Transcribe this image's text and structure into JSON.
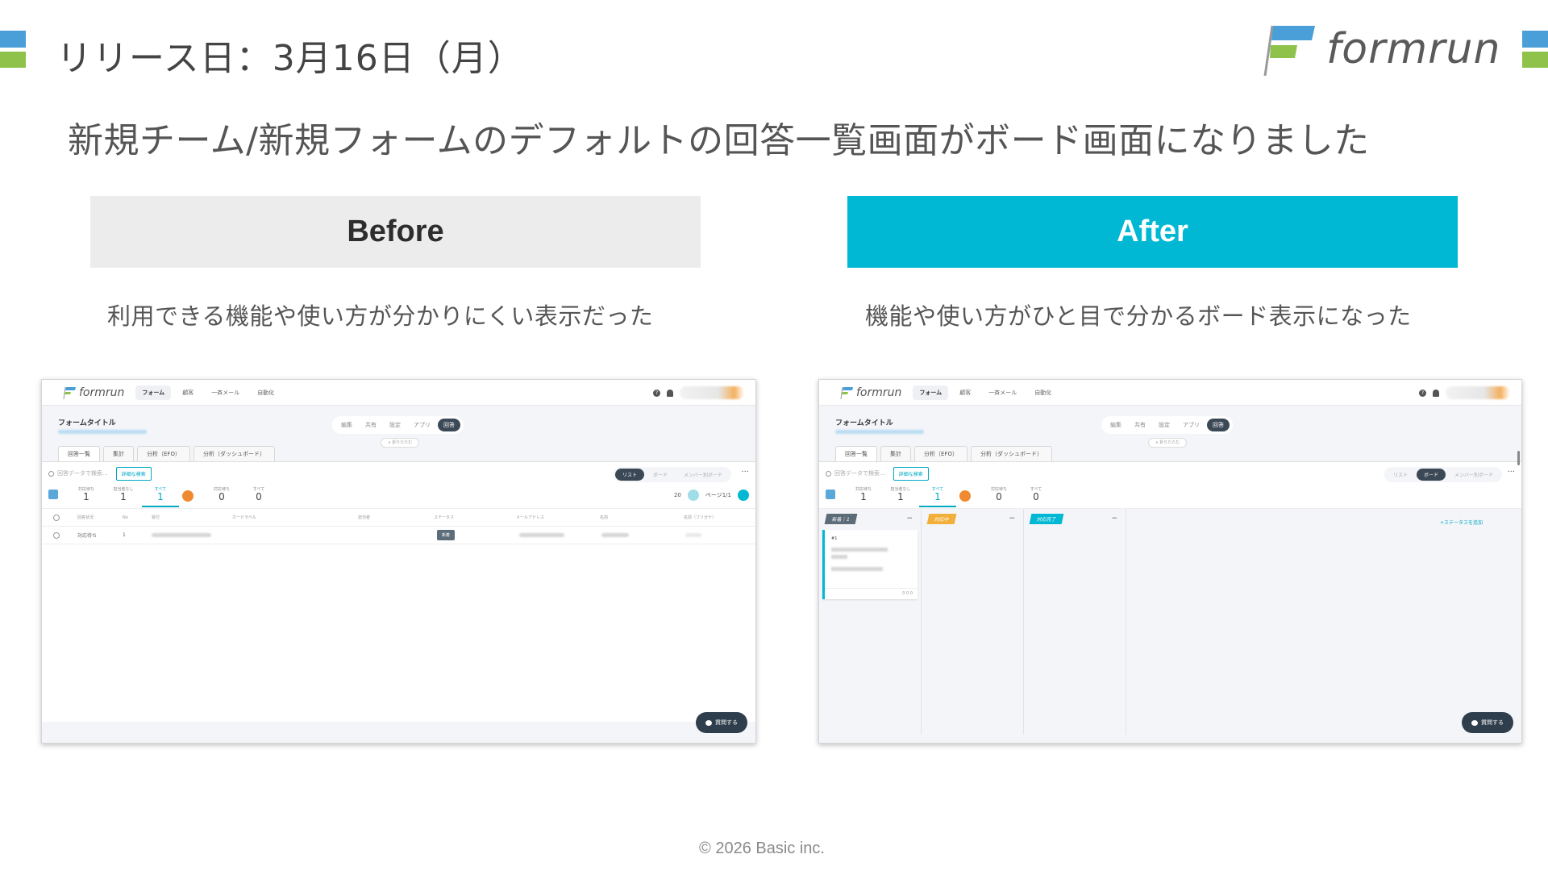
{
  "slide": {
    "release_text": "リリース日：3月16日（月）",
    "brand_name": "formrun",
    "headline": "新規チーム/新規フォームのデフォルトの回答一覧画面がボード画面になりました",
    "before_label": "Before",
    "after_label": "After",
    "before_caption": "利用できる機能や使い方が分かりにくい表示だった",
    "after_caption": "機能や使い方がひと目で分かるボード表示になった",
    "copyright": "© 2026 Basic inc.",
    "colors": {
      "accent": "#00b8d4",
      "brand_blue": "#4a9fd8",
      "brand_green": "#8fc24a"
    }
  },
  "app": {
    "logo": "formrun",
    "nav": [
      "フォーム",
      "顧客",
      "一斉メール",
      "自動化"
    ],
    "help": "?",
    "form_title": "フォームタイトル",
    "subtabs": [
      "編集",
      "共有",
      "設定",
      "アプリ",
      "回答"
    ],
    "collapse": "∧ 折りたたむ",
    "view_tabs": [
      "回答一覧",
      "集計",
      "分析（EFO）",
      "分析（ダッシュボード）"
    ],
    "search_placeholder": "回答データで検索...",
    "advanced_search": "詳細な検索",
    "view_modes": [
      "リスト",
      "ボード",
      "メンバー別ボード"
    ],
    "more": "···",
    "stats": [
      {
        "label": "対応待ち",
        "count": "1"
      },
      {
        "label": "担当者なし",
        "count": "1"
      },
      {
        "label": "すべて",
        "count": "1"
      },
      {
        "label": "対応待ち",
        "count": "0"
      },
      {
        "label": "すべて",
        "count": "0"
      }
    ],
    "per_page": "20",
    "page_info": "ページ1/1",
    "columns": [
      "回答状況",
      "No",
      "受付",
      "カードラベル",
      "担当者",
      "ステータス",
      "メールアドレス",
      "名前",
      "名前（フリガナ）"
    ],
    "row": {
      "state": "対応待ち",
      "no": "1",
      "status": "新着"
    },
    "board_cols": [
      {
        "label": "新着｜1",
        "minus": "−"
      },
      {
        "label": "対応中",
        "minus": "−"
      },
      {
        "label": "対応完了",
        "minus": "−"
      }
    ],
    "card_no": "#1",
    "card_meta": "0  0  0",
    "add_status": "+ステータスを追加",
    "question_btn": "質問する"
  }
}
